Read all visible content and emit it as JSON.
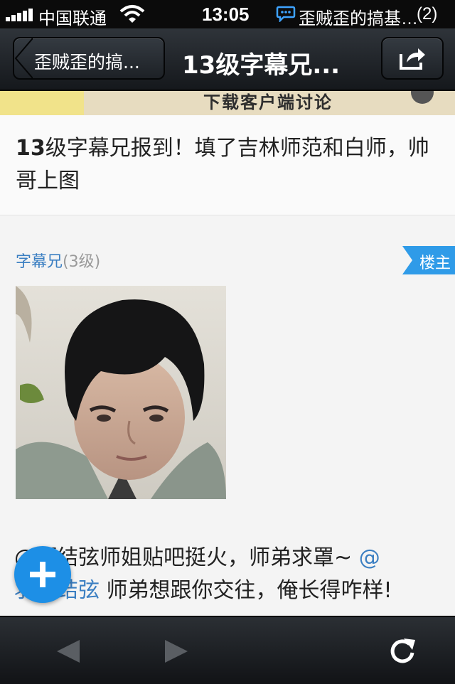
{
  "status_bar": {
    "carrier": "中国联通",
    "time": "13:05",
    "notification": "歪贼歪的搞基…",
    "notification_count": "(2)",
    "icons": [
      "signal-icon",
      "wifi-icon",
      "message-icon"
    ]
  },
  "nav": {
    "back_label": "歪贼歪的搞...",
    "title": "13级字幕兄...",
    "share_icon": "share-icon"
  },
  "banner": {
    "text": "下载客户端讨论"
  },
  "thread": {
    "title_prefix": "13",
    "title_rest": "级字幕兄报到！填了吉林师范和白师，帅哥上图"
  },
  "post": {
    "author": "字幕兄",
    "level": "(3级)",
    "op_badge": "楼主",
    "body_line1": "@而结弦师姐贴吧挺火，师弟求罩~",
    "mention_at": "@",
    "body_line2_mention": "羽生结弦",
    "body_line2_rest": "师弟想跟你交往，俺长得咋样!"
  },
  "fab": {
    "icon": "plus-icon"
  },
  "toolbar": {
    "icons": [
      "back-arrow-icon",
      "forward-arrow-icon",
      "refresh-icon"
    ]
  }
}
